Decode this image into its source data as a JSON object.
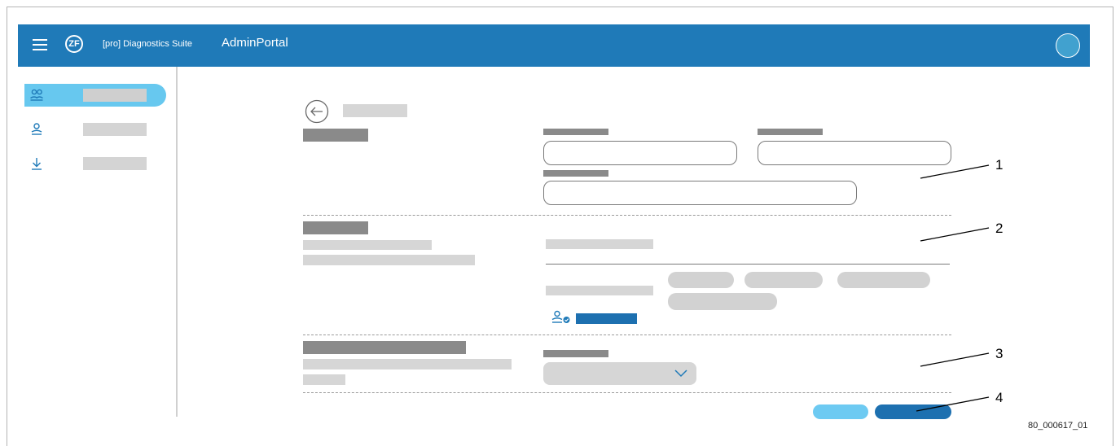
{
  "header": {
    "logo_text": "ZF",
    "product_prefix": "[pro] Diagnostics Suite",
    "app_title": "AdminPortal"
  },
  "sidebar": {
    "items": [
      {
        "icon": "users-group-icon",
        "active": true
      },
      {
        "icon": "user-icon",
        "active": false
      },
      {
        "icon": "download-icon",
        "active": false
      }
    ]
  },
  "callouts": {
    "one": "1",
    "two": "2",
    "three": "3",
    "four": "4"
  },
  "figure_code": "80_000617_01",
  "colors": {
    "header_bg": "#1f7ab8",
    "active_nav": "#67c8ef",
    "primary_button": "#1d70b0",
    "secondary_button": "#6dcaf2"
  }
}
